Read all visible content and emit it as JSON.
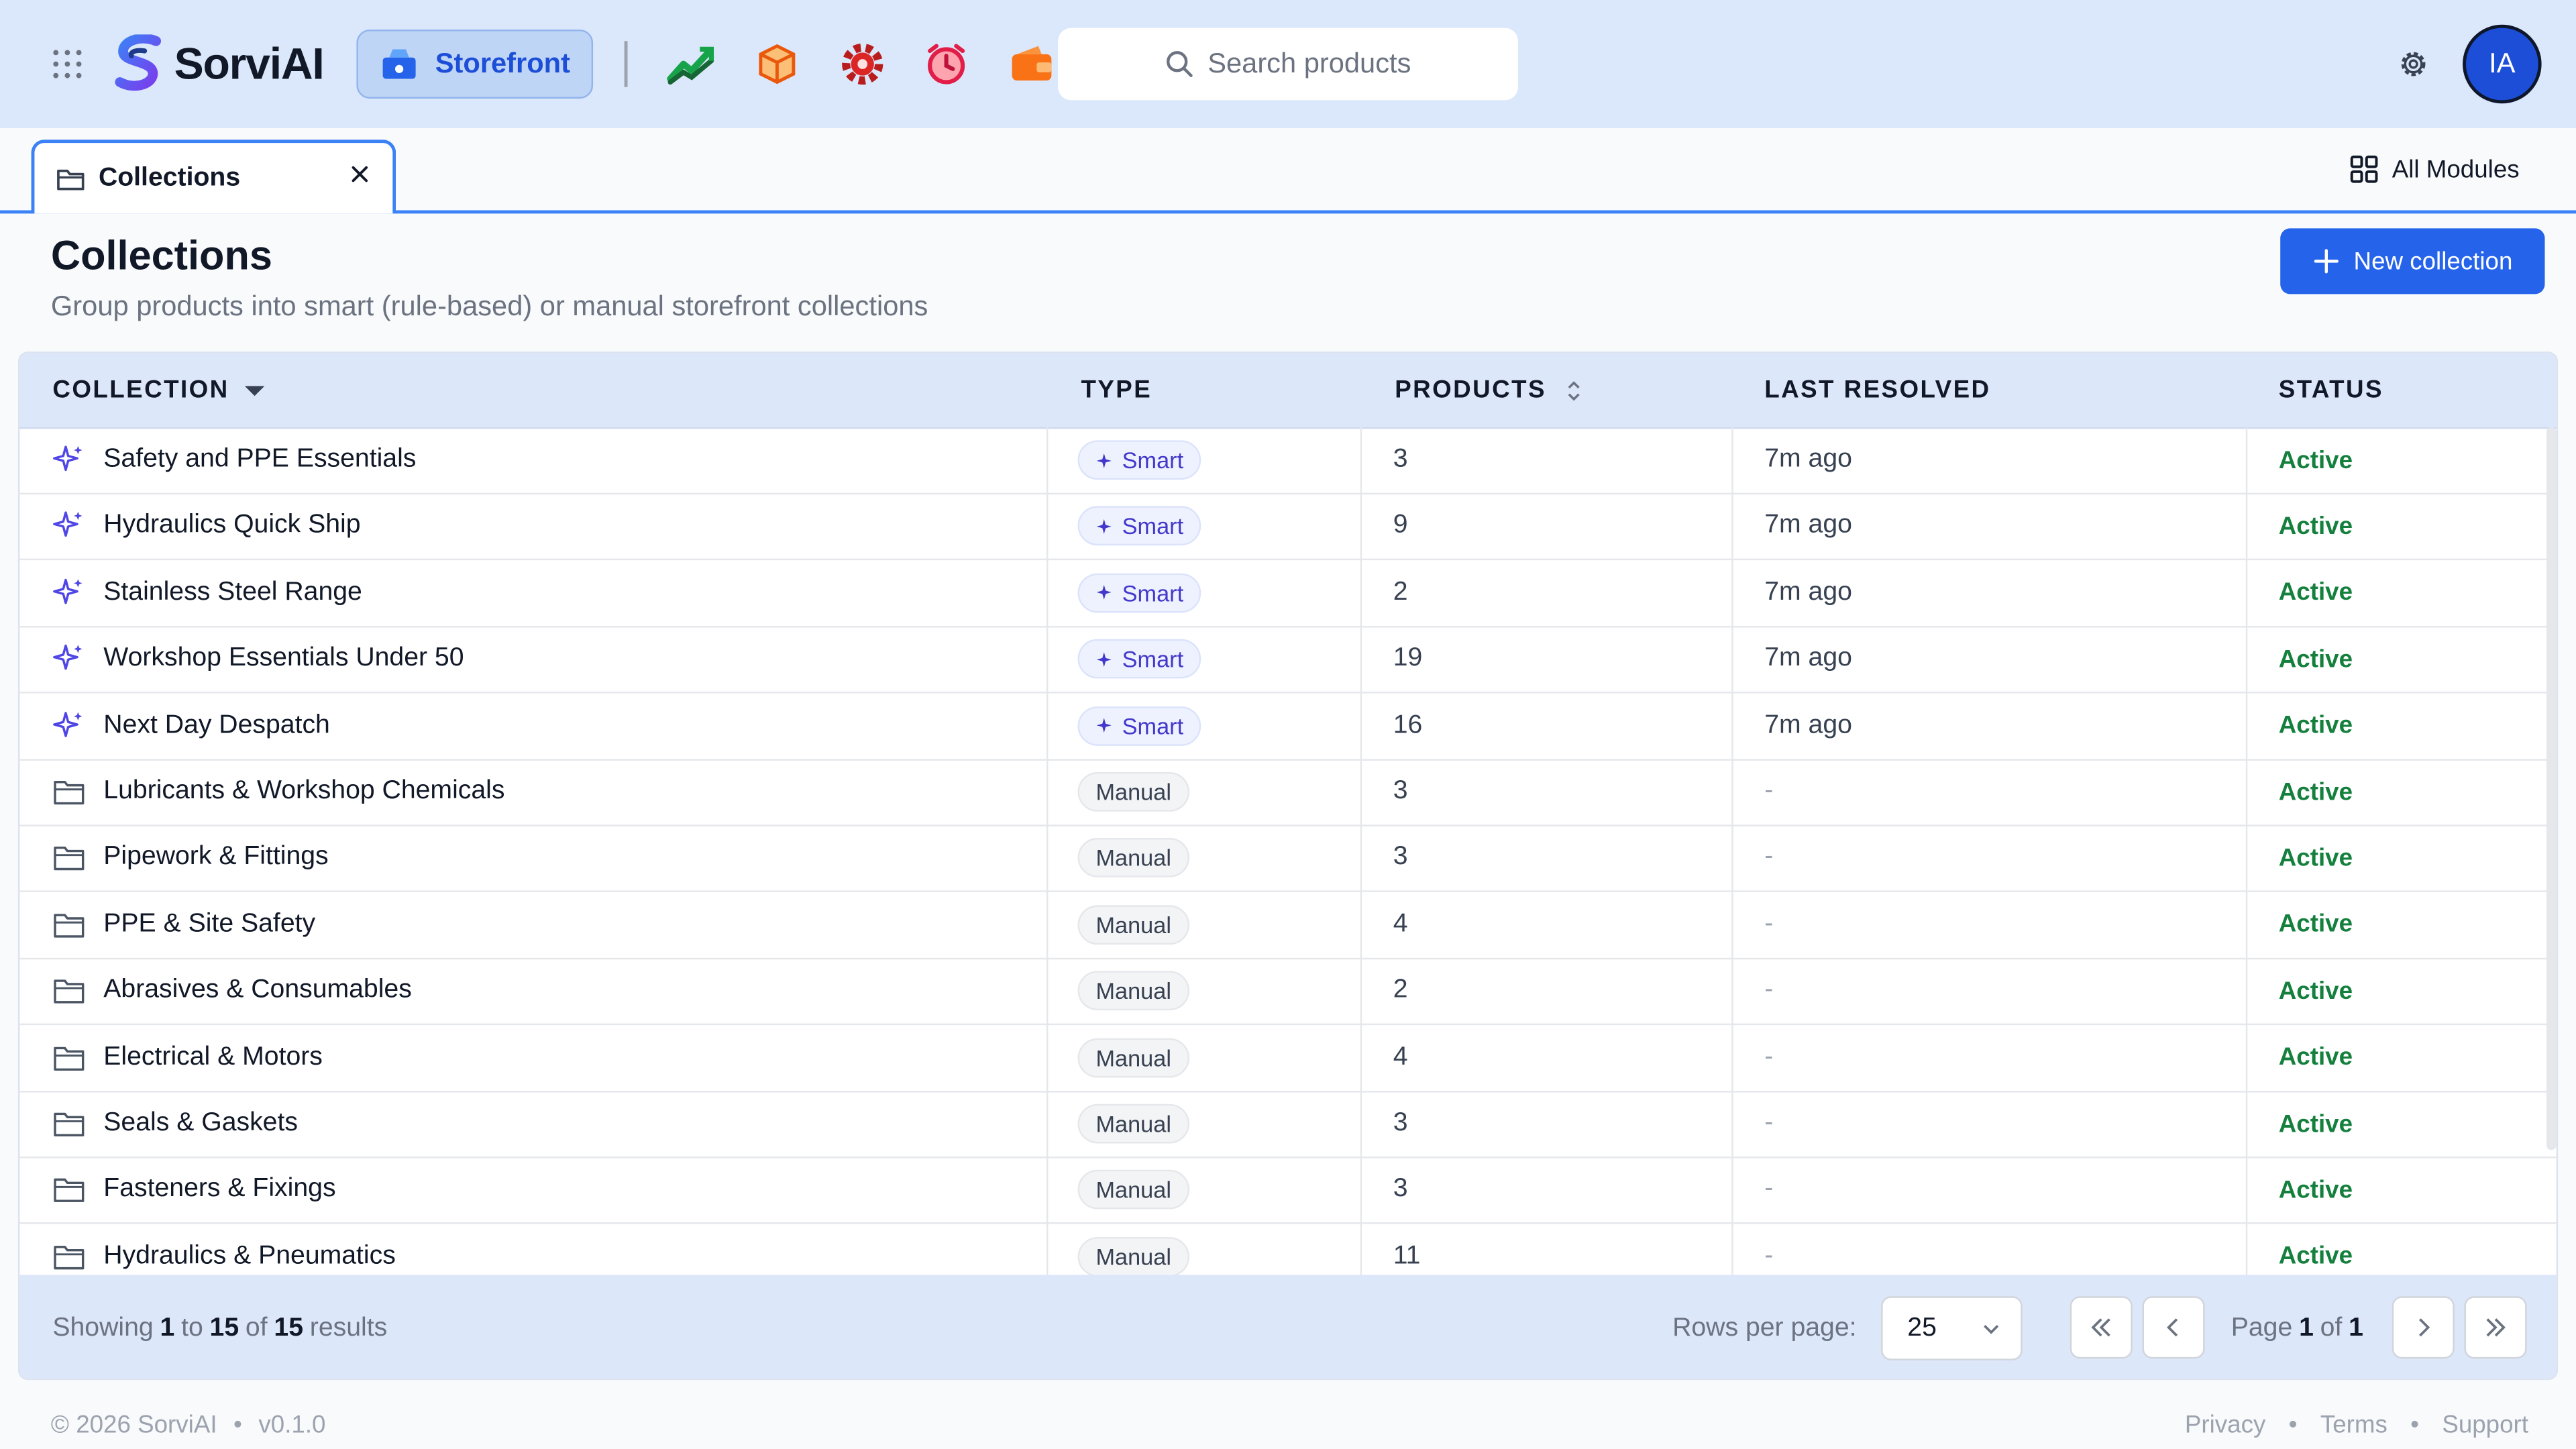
{
  "app": {
    "brand": "SorviAI",
    "module_button": "Storefront",
    "search_placeholder": "Search products",
    "avatar_initials": "IA",
    "accent": "#2563eb"
  },
  "tabs": {
    "active_tab": "Collections",
    "all_modules": "All Modules"
  },
  "page": {
    "title": "Collections",
    "subtitle": "Group products into smart (rule-based) or manual storefront collections",
    "new_button": "New collection"
  },
  "table": {
    "headers": {
      "collection": "COLLECTION",
      "type": "TYPE",
      "products": "PRODUCTS",
      "last_resolved": "LAST RESOLVED",
      "status": "STATUS"
    },
    "rows": [
      {
        "name": "Safety and PPE Essentials",
        "type": "Smart",
        "products": "3",
        "last_resolved": "7m ago",
        "status": "Active"
      },
      {
        "name": "Hydraulics Quick Ship",
        "type": "Smart",
        "products": "9",
        "last_resolved": "7m ago",
        "status": "Active"
      },
      {
        "name": "Stainless Steel Range",
        "type": "Smart",
        "products": "2",
        "last_resolved": "7m ago",
        "status": "Active"
      },
      {
        "name": "Workshop Essentials Under 50",
        "type": "Smart",
        "products": "19",
        "last_resolved": "7m ago",
        "status": "Active"
      },
      {
        "name": "Next Day Despatch",
        "type": "Smart",
        "products": "16",
        "last_resolved": "7m ago",
        "status": "Active"
      },
      {
        "name": "Lubricants & Workshop Chemicals",
        "type": "Manual",
        "products": "3",
        "last_resolved": "-",
        "status": "Active"
      },
      {
        "name": "Pipework & Fittings",
        "type": "Manual",
        "products": "3",
        "last_resolved": "-",
        "status": "Active"
      },
      {
        "name": "PPE & Site Safety",
        "type": "Manual",
        "products": "4",
        "last_resolved": "-",
        "status": "Active"
      },
      {
        "name": "Abrasives & Consumables",
        "type": "Manual",
        "products": "2",
        "last_resolved": "-",
        "status": "Active"
      },
      {
        "name": "Electrical & Motors",
        "type": "Manual",
        "products": "4",
        "last_resolved": "-",
        "status": "Active"
      },
      {
        "name": "Seals & Gaskets",
        "type": "Manual",
        "products": "3",
        "last_resolved": "-",
        "status": "Active"
      },
      {
        "name": "Fasteners & Fixings",
        "type": "Manual",
        "products": "3",
        "last_resolved": "-",
        "status": "Active"
      },
      {
        "name": "Hydraulics & Pneumatics",
        "type": "Manual",
        "products": "11",
        "last_resolved": "-",
        "status": "Active"
      }
    ]
  },
  "pagination": {
    "showing_prefix": "Showing",
    "from": "1",
    "to_word": "to",
    "to": "15",
    "of_word": "of",
    "total": "15",
    "results_word": "results",
    "rows_per_page_label": "Rows per page:",
    "rows_per_page_value": "25",
    "page_word": "Page",
    "current_page": "1",
    "page_of_word": "of",
    "total_pages": "1"
  },
  "footer": {
    "copyright": "© 2026 SorviAI",
    "version": "v0.1.0",
    "links": [
      "Privacy",
      "Terms",
      "Support"
    ]
  }
}
